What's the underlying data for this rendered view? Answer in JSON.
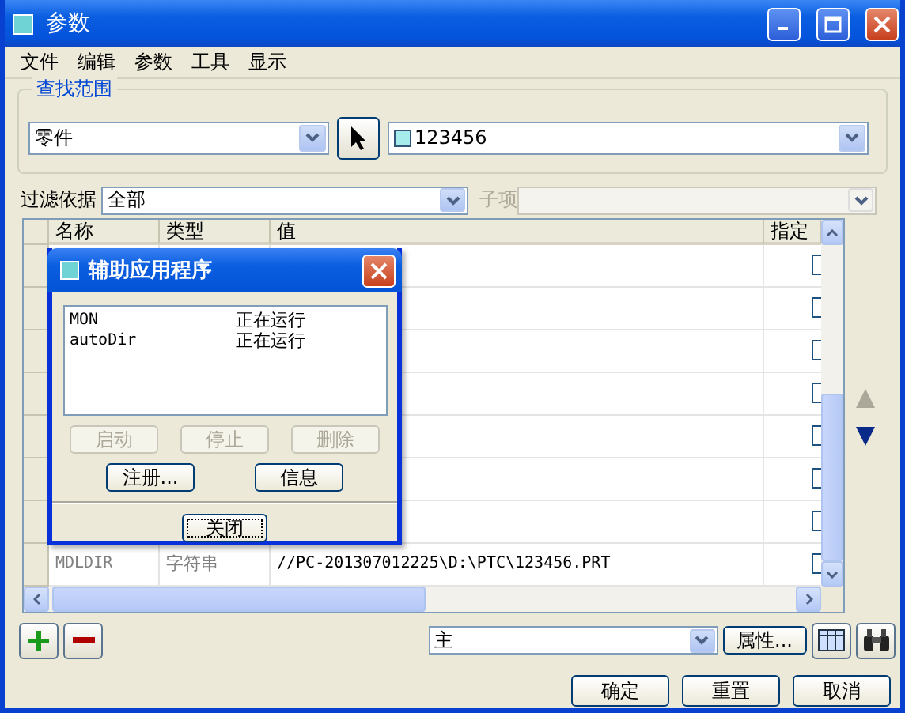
{
  "window": {
    "title": "参数"
  },
  "menu": [
    "文件",
    "编辑",
    "参数",
    "工具",
    "显示"
  ],
  "search_scope": {
    "label": "查找范围",
    "type": "零件",
    "model": "123456"
  },
  "filter": {
    "label": "过滤依据",
    "value": "全部",
    "subitem_label": "子项",
    "subitem_disabled": true
  },
  "table": {
    "columns": [
      "名称",
      "类型",
      "值",
      "指定"
    ],
    "rows": [
      {
        "checked": false
      },
      {
        "checked": false
      },
      {
        "checked": false
      },
      {
        "checked": false
      },
      {
        "checked": false
      },
      {
        "checked": false
      },
      {
        "checked": false
      },
      {
        "name": "MDLDIR",
        "type": "字符串",
        "value": "//PC-201307012225\\D:\\PTC\\123456.PRT",
        "checked": false
      }
    ]
  },
  "reorder": {
    "up_disabled": true,
    "down_disabled": false
  },
  "bottom": {
    "set": "主",
    "properties_button": "属性..."
  },
  "buttons": [
    "确定",
    "重置",
    "取消"
  ],
  "dialog": {
    "title": "辅助应用程序",
    "apps": [
      {
        "name": "MON",
        "status": "正在运行"
      },
      {
        "name": "autoDir",
        "status": "正在运行"
      }
    ],
    "buttons": [
      {
        "label": "启动",
        "disabled": true
      },
      {
        "label": "停止",
        "disabled": true
      },
      {
        "label": "删除",
        "disabled": true
      },
      {
        "label": "注册...",
        "disabled": false
      },
      {
        "label": "信息",
        "disabled": false
      }
    ],
    "close_button": "关闭"
  }
}
